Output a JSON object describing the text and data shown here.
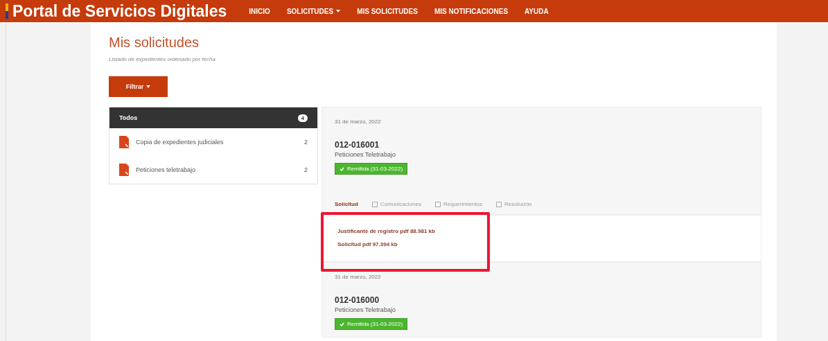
{
  "header": {
    "title": "Portal de Servicios Digitales",
    "nav": [
      {
        "label": "INICIO",
        "dropdown": false
      },
      {
        "label": "SOLICITUDES",
        "dropdown": true
      },
      {
        "label": "MIS SOLICITUDES",
        "dropdown": false
      },
      {
        "label": "MIS NOTIFICACIONES",
        "dropdown": false
      },
      {
        "label": "AYUDA",
        "dropdown": false
      }
    ]
  },
  "page": {
    "title": "Mis solicitudes",
    "subtitle": "Listado de expedientes ordenado por fecha"
  },
  "filter_button": "Filtrar",
  "sidebar": {
    "header": {
      "label": "Todos",
      "count": "4"
    },
    "items": [
      {
        "label": "Copia de expedientes judiciales",
        "count": "2"
      },
      {
        "label": "Peticiones teletrabajo",
        "count": "2"
      }
    ]
  },
  "requests": [
    {
      "date": "31 de marzo, 2022",
      "number": "012-016001",
      "type": "Peticiones Teletrabajo",
      "status": "Remitida (31-03-2022)",
      "tabs": [
        {
          "label": "Solicitud",
          "selected": true
        },
        {
          "label": "Comunicaciones",
          "selected": false
        },
        {
          "label": "Requerimientos",
          "selected": false
        },
        {
          "label": "Resolución",
          "selected": false
        }
      ],
      "documents": [
        "Justificante de registro pdf 88.981 kb",
        "Solicitud pdf 97.394 kb"
      ],
      "highlighted": true
    },
    {
      "date": "31 de marzo, 2022",
      "number": "012-016000",
      "type": "Peticiones Teletrabajo",
      "status": "Remitida (31-03-2022)"
    }
  ]
}
